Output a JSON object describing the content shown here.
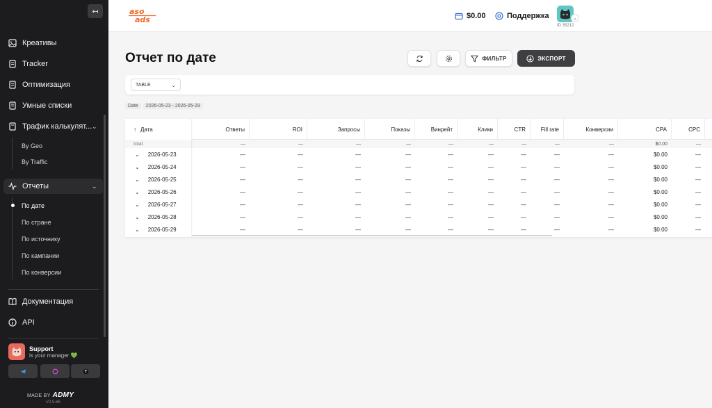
{
  "sidebar": {
    "collapse_icon": "↤",
    "items": [
      {
        "label": "Креативы",
        "icon": "image-icon"
      },
      {
        "label": "Tracker",
        "icon": "document-icon"
      },
      {
        "label": "Оптимизация",
        "icon": "document-icon"
      },
      {
        "label": "Умные списки",
        "icon": "document-icon"
      },
      {
        "label": "Трафик калькулят...",
        "icon": "calculator-icon"
      }
    ],
    "traffic_sub": [
      {
        "label": "By Geo"
      },
      {
        "label": "By Traffic"
      }
    ],
    "reports": {
      "label": "Отчеты",
      "icon": "activity-icon"
    },
    "reports_sub": [
      {
        "label": "По дате",
        "active": true
      },
      {
        "label": "По стране"
      },
      {
        "label": "По источнику"
      },
      {
        "label": "По кампании"
      },
      {
        "label": "По конверсии"
      }
    ],
    "docs": {
      "label": "Документация",
      "icon": "book-icon"
    },
    "api": {
      "label": "API",
      "icon": "info-icon"
    },
    "support": {
      "title": "Support",
      "subtitle": "is your manager 💚"
    },
    "made_by": "MADE BY",
    "brand": "ADMY",
    "version": "V2.5.66"
  },
  "header": {
    "logo_top": "aso",
    "logo_bottom": "ads",
    "balance": "$0.00",
    "support_label": "Поддержка",
    "user_id": "ID 35212"
  },
  "page": {
    "title": "Отчет по дате",
    "filter_label": "ФИЛЬТР",
    "export_label": "ЭКСПОРТ",
    "view_select": "TABLE",
    "date_key": "Date",
    "date_range": "2026-05-23 - 2026-05-29"
  },
  "table": {
    "date_header": "Дата",
    "headers": [
      "Ответы",
      "ROI",
      "Запросы",
      "Показы",
      "Винрейт",
      "Клики",
      "CTR",
      "Fill rate",
      "Конверсии",
      "CPA",
      "CPC"
    ],
    "total": {
      "label": "total",
      "cells": [
        "—",
        "—",
        "—",
        "—",
        "—",
        "—",
        "—",
        "—",
        "—",
        "$0.00",
        "—"
      ]
    },
    "rows": [
      {
        "date": "2026-05-23",
        "cells": [
          "—",
          "—",
          "—",
          "—",
          "—",
          "—",
          "—",
          "—",
          "—",
          "$0.00",
          "—"
        ]
      },
      {
        "date": "2026-05-24",
        "cells": [
          "—",
          "—",
          "—",
          "—",
          "—",
          "—",
          "—",
          "—",
          "—",
          "$0.00",
          "—"
        ]
      },
      {
        "date": "2026-05-25",
        "cells": [
          "—",
          "—",
          "—",
          "—",
          "—",
          "—",
          "—",
          "—",
          "—",
          "$0.00",
          "—"
        ]
      },
      {
        "date": "2026-05-26",
        "cells": [
          "—",
          "—",
          "—",
          "—",
          "—",
          "—",
          "—",
          "—",
          "—",
          "$0.00",
          "—"
        ]
      },
      {
        "date": "2026-05-27",
        "cells": [
          "—",
          "—",
          "—",
          "—",
          "—",
          "—",
          "—",
          "—",
          "—",
          "$0.00",
          "—"
        ]
      },
      {
        "date": "2026-05-28",
        "cells": [
          "—",
          "—",
          "—",
          "—",
          "—",
          "—",
          "—",
          "—",
          "—",
          "$0.00",
          "—"
        ]
      },
      {
        "date": "2026-05-29",
        "cells": [
          "—",
          "—",
          "—",
          "—",
          "—",
          "—",
          "—",
          "—",
          "—",
          "$0.00",
          "—"
        ]
      }
    ]
  }
}
